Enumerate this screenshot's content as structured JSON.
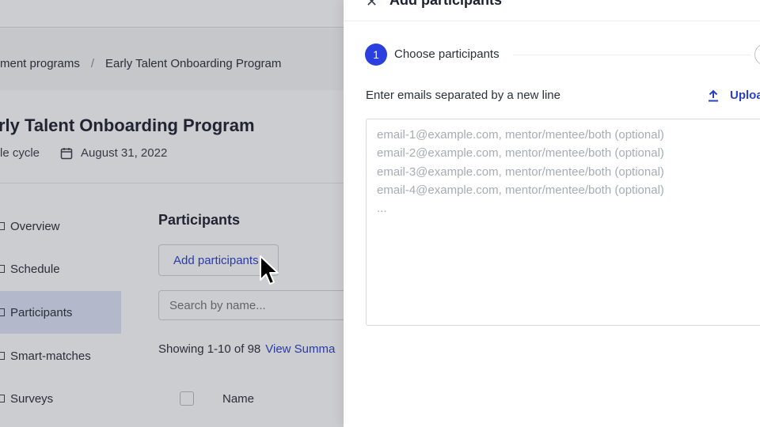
{
  "background": {
    "breadcrumb": {
      "parent": "ment programs",
      "separator": "/",
      "current": "Early Talent Onboarding Program"
    },
    "program": {
      "title": "rly Talent Onboarding Program",
      "cycle": "le cycle",
      "date": "August 31, 2022"
    },
    "sidebar": {
      "items": [
        {
          "label": "Overview",
          "active": false
        },
        {
          "label": "Schedule",
          "active": false
        },
        {
          "label": "Participants",
          "active": true
        },
        {
          "label": "Smart-matches",
          "active": false
        },
        {
          "label": "Surveys",
          "active": false
        }
      ]
    },
    "participants": {
      "title": "Participants",
      "add_button": "Add participants",
      "search_placeholder": "Search by name...",
      "showing": "Showing 1-10 of 98",
      "view_summary": "View Summa",
      "col_name": "Name"
    }
  },
  "drawer": {
    "title": "Add participants",
    "close_icon": "close-icon",
    "step": {
      "number": "1",
      "label": "Choose participants"
    },
    "email_label": "Enter emails separated by a new line",
    "upload_label": "Uploa",
    "placeholder_lines": [
      "email-1@example.com, mentor/mentee/both (optional)",
      "email-2@example.com, mentor/mentee/both (optional)",
      "email-3@example.com, mentor/mentee/both (optional)",
      "email-4@example.com, mentor/mentee/both (optional)",
      "..."
    ]
  },
  "colors": {
    "accent": "#2b3fdf",
    "link": "#2b3fc7",
    "active_nav": "#dfe5f7"
  }
}
